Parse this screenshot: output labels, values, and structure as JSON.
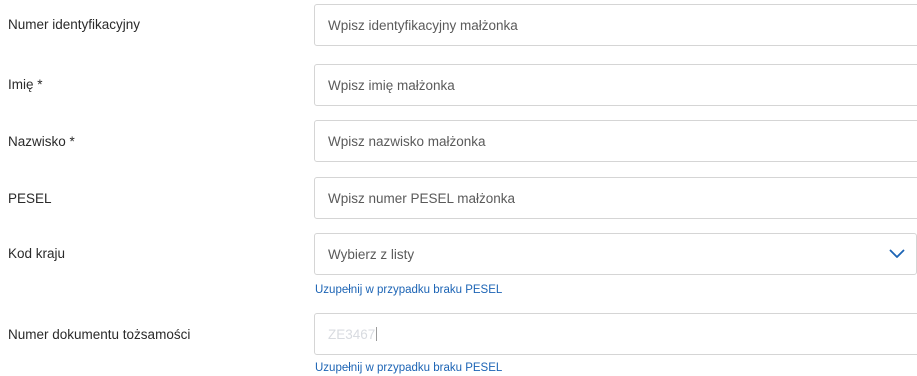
{
  "form": {
    "id_number": {
      "label": "Numer identyfikacyjny",
      "placeholder": "Wpisz identyfikacyjny małżonka"
    },
    "first_name": {
      "label": "Imię *",
      "placeholder": "Wpisz imię małżonka"
    },
    "last_name": {
      "label": "Nazwisko *",
      "placeholder": "Wpisz nazwisko małżonka"
    },
    "pesel": {
      "label": "PESEL",
      "placeholder": "Wpisz numer PESEL małżonka"
    },
    "country_code": {
      "label": "Kod kraju",
      "selected": "Wybierz z listy",
      "hint": "Uzupełnij w przypadku braku PESEL",
      "icon": "chevron-down-icon"
    },
    "id_document": {
      "label": "Numer dokumentu tożsamości",
      "value": "ZE3467",
      "hint": "Uzupełnij w przypadku braku PESEL"
    }
  },
  "colors": {
    "hint": "#1c64b5",
    "chevron": "#1c64b5",
    "border": "#d5d5d5",
    "faded_value": "#d8dbe0"
  }
}
